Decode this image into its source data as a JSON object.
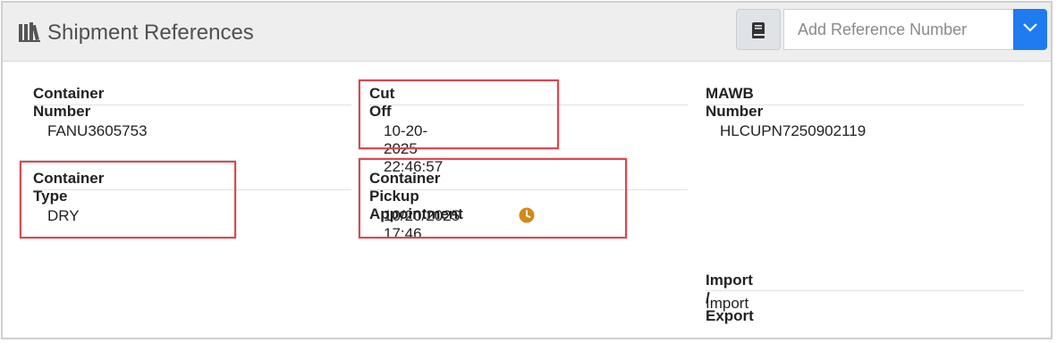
{
  "header": {
    "title": "Shipment References",
    "title_icon": "library-books-icon",
    "book_button_icon": "book-icon",
    "reference_input_placeholder": "Add Reference Number",
    "dropdown_icon": "chevron-down-icon"
  },
  "fields": {
    "container_number": {
      "label": "Container Number",
      "value": "FANU3605753"
    },
    "cut_off": {
      "label": "Cut Off",
      "value": "10-20-2025 22:46:57"
    },
    "mawb_number": {
      "label": "MAWB Number",
      "value": "HLCUPN7250902119"
    },
    "container_type": {
      "label": "Container Type",
      "value": "DRY"
    },
    "container_pickup_appointment": {
      "label": "Container Pickup Appointment",
      "value": "10/20/2025 17:46",
      "icon": "clock-icon"
    },
    "import_export": {
      "label": "Import / Export",
      "value": "Import"
    }
  },
  "colors": {
    "accent": "#1e7bf0",
    "highlight_border": "#e0464e",
    "clock": "#d28a1a"
  }
}
